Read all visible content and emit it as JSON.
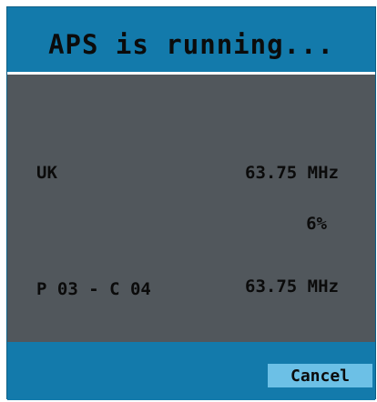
{
  "dialog": {
    "title": "APS is running...",
    "region": "UK",
    "current_frequency": "63.75 MHz",
    "progress_percent": "6%",
    "progress_value": 0.06,
    "channel": "P 03 - C 04",
    "channel_frequency": "63.75 MHz",
    "cancel_label": "Cancel"
  },
  "colors": {
    "header": "#137aab",
    "content": "#51575c",
    "button": "#6cc0e6",
    "text": "#0b0b0b"
  }
}
